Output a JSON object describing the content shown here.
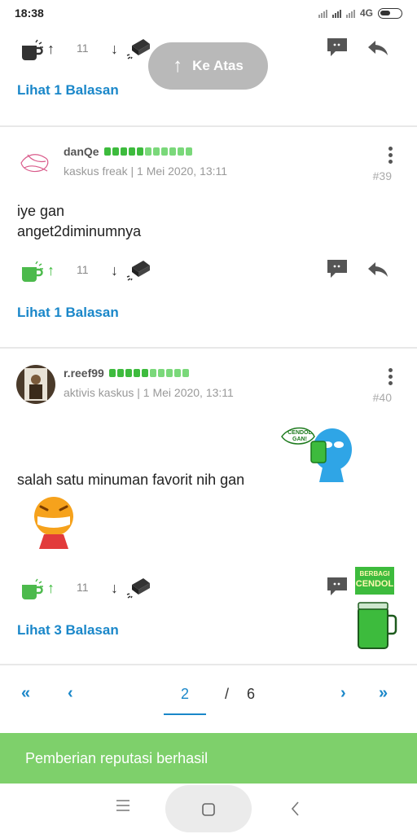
{
  "status_bar": {
    "time": "18:38",
    "network": "4G"
  },
  "scroll_top_button": {
    "label": "Ke Atas"
  },
  "comments": [
    {
      "votes": "11",
      "replies_link": "Lihat 1 Balasan"
    },
    {
      "username": "danQe",
      "rank": "kaskus freak",
      "date": "1 Mei 2020, 13:11",
      "post_number": "#39",
      "lines": [
        "iye gan",
        "anget2diminumnya"
      ],
      "votes": "11",
      "replies_link": "Lihat 1 Balasan"
    },
    {
      "username": "r.reef99",
      "rank": "aktivis kaskus",
      "date": "1 Mei 2020, 13:11",
      "post_number": "#40",
      "text": "salah satu minuman favorit nih gan",
      "sticker_text": "CENDOL GAN!",
      "badge_text": [
        "BERBAGI",
        "CENDOL"
      ],
      "votes": "11",
      "replies_link": "Lihat 3 Balasan"
    }
  ],
  "pagination": {
    "current": "2",
    "separator": "/",
    "total": "6"
  },
  "toast": {
    "message": "Pemberian reputasi berhasil"
  },
  "colors": {
    "link_blue": "#1a87c9",
    "rep_green": "#3dbb3d",
    "toast_green": "#7ed06b",
    "button_grey": "#b9b9b9"
  }
}
